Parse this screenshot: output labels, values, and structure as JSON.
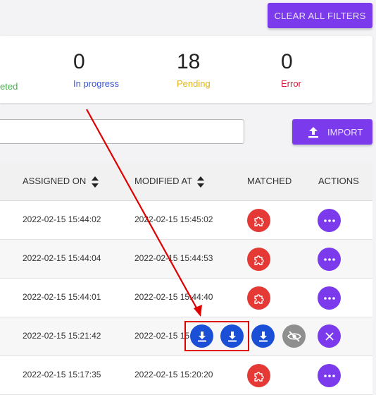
{
  "toolbar": {
    "clear_filters_label": "CLEAR ALL FILTERS",
    "import_label": "IMPORT"
  },
  "stats": [
    {
      "value": "",
      "label": "eted",
      "color": "#43b049"
    },
    {
      "value": "0",
      "label": "In progress",
      "color": "#3b55d9"
    },
    {
      "value": "18",
      "label": "Pending",
      "color": "#e0b31a"
    },
    {
      "value": "0",
      "label": "Error",
      "color": "#d81b3c"
    }
  ],
  "search": {
    "value": ""
  },
  "table": {
    "headers": {
      "assigned_on": "ASSIGNED ON",
      "modified_at": "MODIFIED AT",
      "matched": "MATCHED",
      "actions": "ACTIONS"
    },
    "rows": [
      {
        "assigned_on": "2022-02-15 15:44:02",
        "modified_at": "2022-02-15 15:45:02"
      },
      {
        "assigned_on": "2022-02-15 15:44:04",
        "modified_at": "2022-02-15 15:44:53"
      },
      {
        "assigned_on": "2022-02-15 15:44:01",
        "modified_at": "2022-02-15 15:44:40"
      },
      {
        "assigned_on": "2022-02-15 15:21:42",
        "modified_at": "2022-02-15 15"
      },
      {
        "assigned_on": "2022-02-15 15:17:35",
        "modified_at": "2022-02-15 15:20:20"
      }
    ]
  },
  "icons": {
    "matched": "puzzle-icon",
    "actions": "more-horizontal-icon",
    "download": "download-icon",
    "hide": "eye-off-icon",
    "close": "close-icon"
  },
  "colors": {
    "accent": "#7c3aed",
    "matched_red": "#e53935",
    "download_blue": "#1a4fd6",
    "annotation_red": "#e00000"
  }
}
